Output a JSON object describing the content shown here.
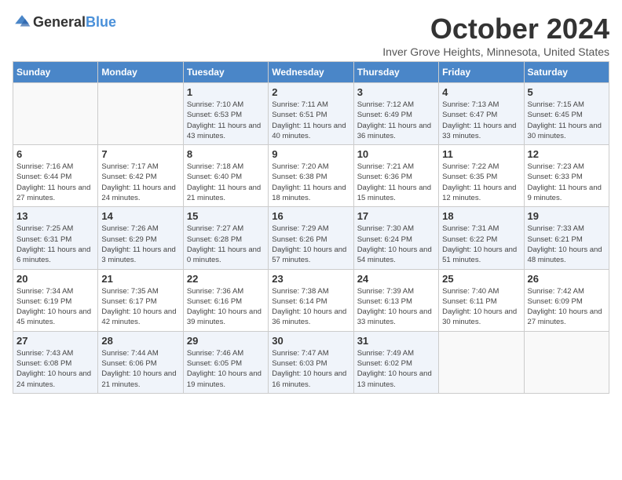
{
  "header": {
    "logo_general": "General",
    "logo_blue": "Blue",
    "month_title": "October 2024",
    "subtitle": "Inver Grove Heights, Minnesota, United States"
  },
  "days_of_week": [
    "Sunday",
    "Monday",
    "Tuesday",
    "Wednesday",
    "Thursday",
    "Friday",
    "Saturday"
  ],
  "weeks": [
    [
      {
        "day": "",
        "info": ""
      },
      {
        "day": "",
        "info": ""
      },
      {
        "day": "1",
        "info": "Sunrise: 7:10 AM\nSunset: 6:53 PM\nDaylight: 11 hours and 43 minutes."
      },
      {
        "day": "2",
        "info": "Sunrise: 7:11 AM\nSunset: 6:51 PM\nDaylight: 11 hours and 40 minutes."
      },
      {
        "day": "3",
        "info": "Sunrise: 7:12 AM\nSunset: 6:49 PM\nDaylight: 11 hours and 36 minutes."
      },
      {
        "day": "4",
        "info": "Sunrise: 7:13 AM\nSunset: 6:47 PM\nDaylight: 11 hours and 33 minutes."
      },
      {
        "day": "5",
        "info": "Sunrise: 7:15 AM\nSunset: 6:45 PM\nDaylight: 11 hours and 30 minutes."
      }
    ],
    [
      {
        "day": "6",
        "info": "Sunrise: 7:16 AM\nSunset: 6:44 PM\nDaylight: 11 hours and 27 minutes."
      },
      {
        "day": "7",
        "info": "Sunrise: 7:17 AM\nSunset: 6:42 PM\nDaylight: 11 hours and 24 minutes."
      },
      {
        "day": "8",
        "info": "Sunrise: 7:18 AM\nSunset: 6:40 PM\nDaylight: 11 hours and 21 minutes."
      },
      {
        "day": "9",
        "info": "Sunrise: 7:20 AM\nSunset: 6:38 PM\nDaylight: 11 hours and 18 minutes."
      },
      {
        "day": "10",
        "info": "Sunrise: 7:21 AM\nSunset: 6:36 PM\nDaylight: 11 hours and 15 minutes."
      },
      {
        "day": "11",
        "info": "Sunrise: 7:22 AM\nSunset: 6:35 PM\nDaylight: 11 hours and 12 minutes."
      },
      {
        "day": "12",
        "info": "Sunrise: 7:23 AM\nSunset: 6:33 PM\nDaylight: 11 hours and 9 minutes."
      }
    ],
    [
      {
        "day": "13",
        "info": "Sunrise: 7:25 AM\nSunset: 6:31 PM\nDaylight: 11 hours and 6 minutes."
      },
      {
        "day": "14",
        "info": "Sunrise: 7:26 AM\nSunset: 6:29 PM\nDaylight: 11 hours and 3 minutes."
      },
      {
        "day": "15",
        "info": "Sunrise: 7:27 AM\nSunset: 6:28 PM\nDaylight: 11 hours and 0 minutes."
      },
      {
        "day": "16",
        "info": "Sunrise: 7:29 AM\nSunset: 6:26 PM\nDaylight: 10 hours and 57 minutes."
      },
      {
        "day": "17",
        "info": "Sunrise: 7:30 AM\nSunset: 6:24 PM\nDaylight: 10 hours and 54 minutes."
      },
      {
        "day": "18",
        "info": "Sunrise: 7:31 AM\nSunset: 6:22 PM\nDaylight: 10 hours and 51 minutes."
      },
      {
        "day": "19",
        "info": "Sunrise: 7:33 AM\nSunset: 6:21 PM\nDaylight: 10 hours and 48 minutes."
      }
    ],
    [
      {
        "day": "20",
        "info": "Sunrise: 7:34 AM\nSunset: 6:19 PM\nDaylight: 10 hours and 45 minutes."
      },
      {
        "day": "21",
        "info": "Sunrise: 7:35 AM\nSunset: 6:17 PM\nDaylight: 10 hours and 42 minutes."
      },
      {
        "day": "22",
        "info": "Sunrise: 7:36 AM\nSunset: 6:16 PM\nDaylight: 10 hours and 39 minutes."
      },
      {
        "day": "23",
        "info": "Sunrise: 7:38 AM\nSunset: 6:14 PM\nDaylight: 10 hours and 36 minutes."
      },
      {
        "day": "24",
        "info": "Sunrise: 7:39 AM\nSunset: 6:13 PM\nDaylight: 10 hours and 33 minutes."
      },
      {
        "day": "25",
        "info": "Sunrise: 7:40 AM\nSunset: 6:11 PM\nDaylight: 10 hours and 30 minutes."
      },
      {
        "day": "26",
        "info": "Sunrise: 7:42 AM\nSunset: 6:09 PM\nDaylight: 10 hours and 27 minutes."
      }
    ],
    [
      {
        "day": "27",
        "info": "Sunrise: 7:43 AM\nSunset: 6:08 PM\nDaylight: 10 hours and 24 minutes."
      },
      {
        "day": "28",
        "info": "Sunrise: 7:44 AM\nSunset: 6:06 PM\nDaylight: 10 hours and 21 minutes."
      },
      {
        "day": "29",
        "info": "Sunrise: 7:46 AM\nSunset: 6:05 PM\nDaylight: 10 hours and 19 minutes."
      },
      {
        "day": "30",
        "info": "Sunrise: 7:47 AM\nSunset: 6:03 PM\nDaylight: 10 hours and 16 minutes."
      },
      {
        "day": "31",
        "info": "Sunrise: 7:49 AM\nSunset: 6:02 PM\nDaylight: 10 hours and 13 minutes."
      },
      {
        "day": "",
        "info": ""
      },
      {
        "day": "",
        "info": ""
      }
    ]
  ]
}
